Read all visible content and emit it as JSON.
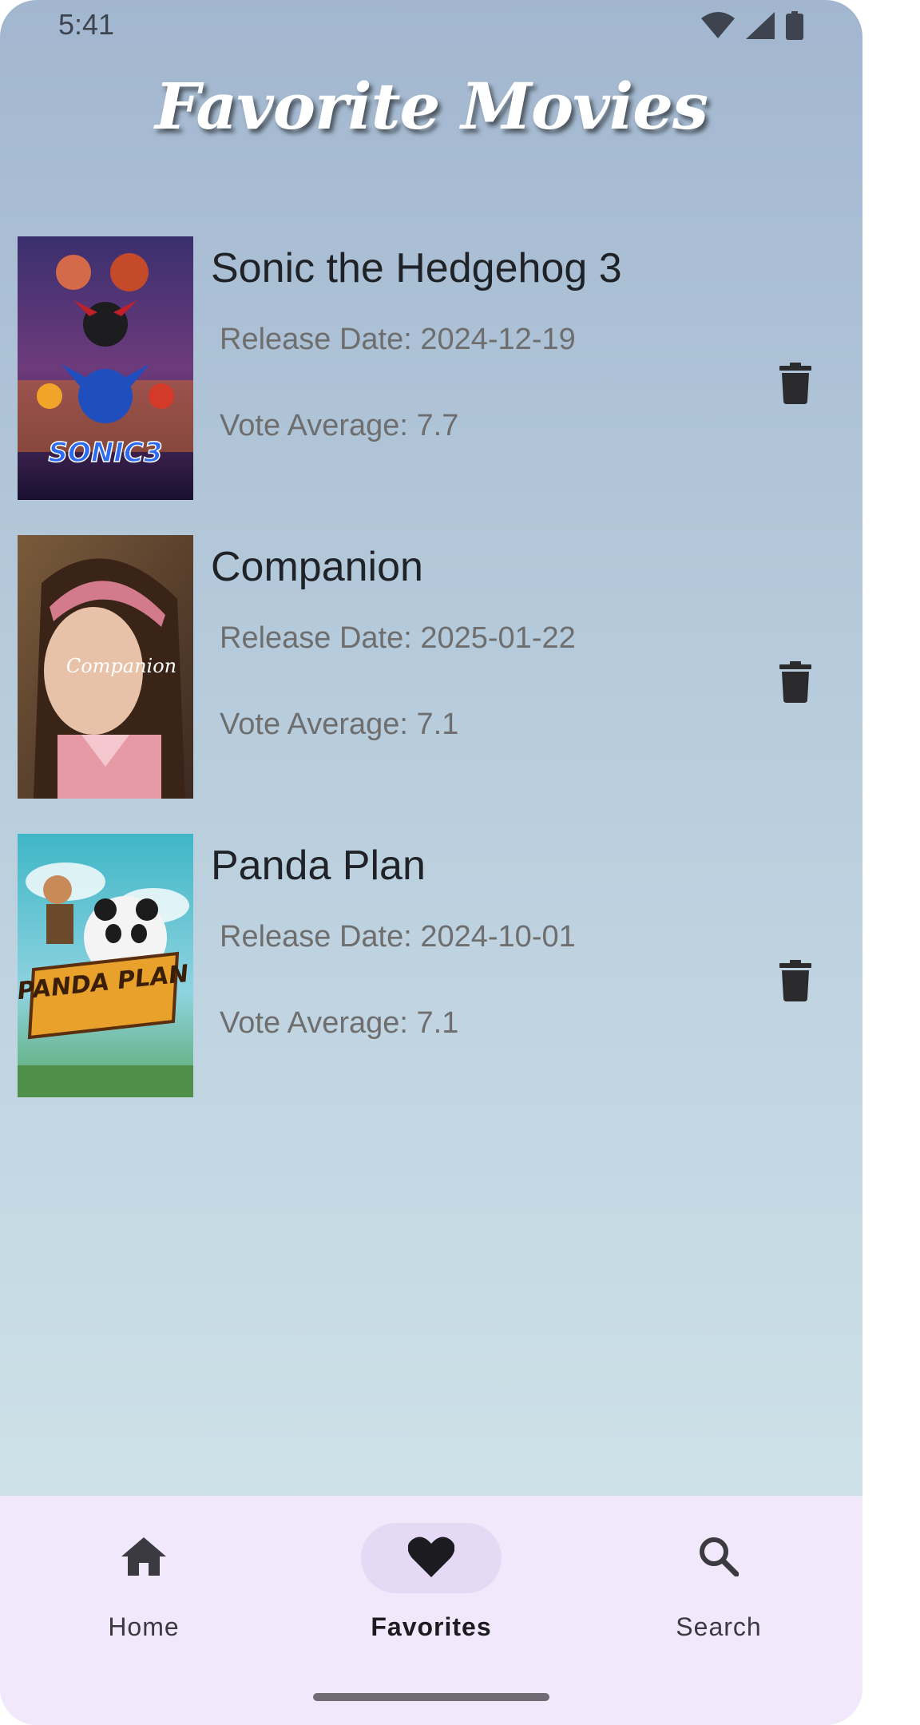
{
  "status_bar": {
    "time": "5:41",
    "icons": [
      "wifi-icon",
      "cellular-signal-icon",
      "battery-icon"
    ]
  },
  "header": {
    "title": "Favorite Movies"
  },
  "movies": [
    {
      "title": "Sonic the Hedgehog 3",
      "release_date": "Release Date: 2024-12-19",
      "vote_average": "Vote Average: 7.7",
      "poster_text": "SONIC3",
      "delete_icon": "trash-icon"
    },
    {
      "title": "Companion",
      "release_date": "Release Date: 2025-01-22",
      "vote_average": "Vote Average: 7.1",
      "poster_text": "Companion",
      "delete_icon": "trash-icon"
    },
    {
      "title": "Panda Plan",
      "release_date": "Release Date: 2024-10-01",
      "vote_average": "Vote Average: 7.1",
      "poster_text": "PANDA PLAN",
      "delete_icon": "trash-icon"
    }
  ],
  "bottom_nav": {
    "items": [
      {
        "label": "Home",
        "icon": "home-icon",
        "active": false
      },
      {
        "label": "Favorites",
        "icon": "heart-icon",
        "active": true
      },
      {
        "label": "Search",
        "icon": "search-icon",
        "active": false
      }
    ]
  },
  "colors": {
    "gradient_top": "#a2b7cf",
    "gradient_bottom": "#d4e7ec",
    "nav_background": "#f1e8fb",
    "nav_active_pill": "#e6d9f5",
    "icon_dark": "#2b2b2e"
  }
}
